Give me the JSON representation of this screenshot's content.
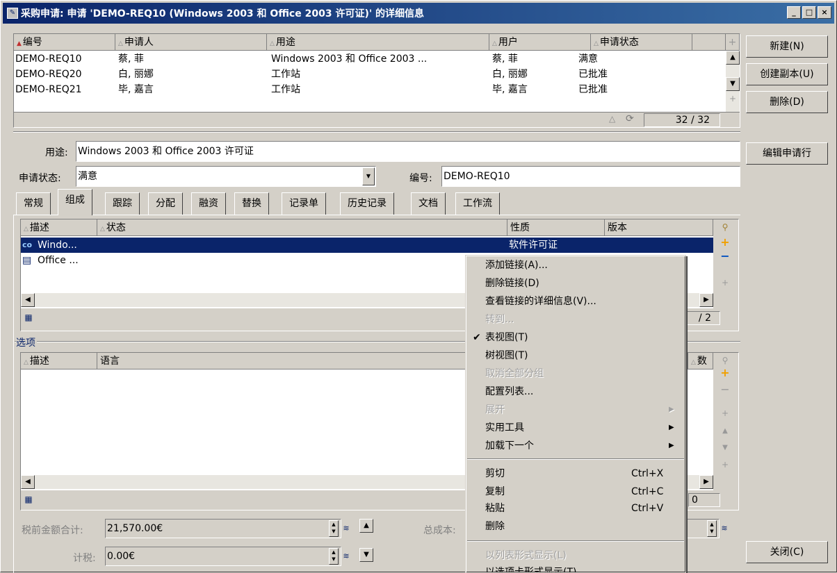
{
  "window": {
    "title": "采购申请: 申请 'DEMO-REQ10 (Windows 2003 和 Office 2003 许可证)' 的详细信息",
    "min": "_",
    "max": "□",
    "close": "×"
  },
  "top_list": {
    "headers": [
      "编号",
      "申请人",
      "用途",
      "用户",
      "申请状态"
    ],
    "rows": [
      [
        "DEMO-REQ10",
        "蔡, 菲",
        "Windows 2003 和 Office 2003 ...",
        "蔡, 菲",
        "满意"
      ],
      [
        "DEMO-REQ20",
        "白, 丽娜",
        "工作站",
        "白, 丽娜",
        "已批准"
      ],
      [
        "DEMO-REQ21",
        "毕, 嘉言",
        "工作站",
        "毕, 嘉言",
        "已批准"
      ]
    ],
    "count": "32 / 32"
  },
  "right_buttons": {
    "new": "新建(N)",
    "copy": "创建副本(U)",
    "delete": "删除(D)",
    "edit_line": "编辑申请行",
    "close": "关闭(C)"
  },
  "form": {
    "purpose_label": "用途:",
    "purpose_value": "Windows 2003 和 Office 2003 许可证",
    "status_label": "申请状态:",
    "status_value": "满意",
    "number_label": "编号:",
    "number_value": "DEMO-REQ10"
  },
  "tabs": [
    "常规",
    "组成",
    "跟踪",
    "分配",
    "融资",
    "替换",
    "记录单",
    "历史记录",
    "文档",
    "工作流"
  ],
  "composition": {
    "headers": [
      "描述",
      "状态",
      "性质",
      "版本"
    ],
    "rows": [
      {
        "desc": "Windo...",
        "nature": "软件许可证"
      },
      {
        "desc": "Office ...",
        "nature": ""
      }
    ],
    "count": "/ 2"
  },
  "options": {
    "title": "选项",
    "headers": [
      "描述",
      "语言",
      "数"
    ],
    "count": "0"
  },
  "totals": {
    "pretax_label": "税前金额合计:",
    "pretax_value": "21,570.00€",
    "tax_label": "计税:",
    "tax_value": "0.00€",
    "total_cost_label": "总成本:"
  },
  "context_menu": {
    "items": [
      {
        "label": "添加链接(A)...",
        "disabled": false
      },
      {
        "label": "删除链接(D)",
        "disabled": false
      },
      {
        "label": "查看链接的详细信息(V)...",
        "disabled": false
      },
      {
        "label": "转到...",
        "disabled": true
      },
      {
        "label": "表视图(T)",
        "disabled": false,
        "checked": "✔"
      },
      {
        "label": "树视图(T)",
        "disabled": false
      },
      {
        "label": "取消全部分组",
        "disabled": true
      },
      {
        "label": "配置列表...",
        "disabled": false
      },
      {
        "label": "展开",
        "disabled": true,
        "submenu": "▶"
      },
      {
        "label": "实用工具",
        "disabled": false,
        "submenu": "▶"
      },
      {
        "label": "加载下一个",
        "disabled": false,
        "submenu": "▶"
      },
      {
        "label": "剪切",
        "shortcut": "Ctrl+X"
      },
      {
        "label": "复制",
        "shortcut": "Ctrl+C"
      },
      {
        "label": "粘贴",
        "shortcut": "Ctrl+V"
      },
      {
        "label": "删除"
      },
      {
        "label": "以列表形式显示(L)",
        "disabled": true
      },
      {
        "label": "以选项卡形式显示(T)",
        "disabled": false
      }
    ]
  },
  "colors": {
    "selection": "#0a246a",
    "face": "#d4d0c8",
    "add_icon": "#f0a000"
  }
}
